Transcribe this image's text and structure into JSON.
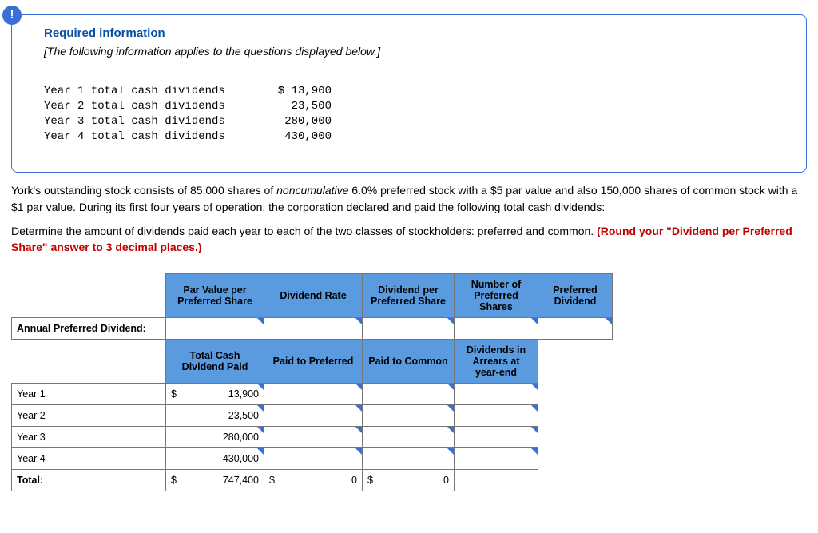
{
  "info": {
    "required_label": "Required information",
    "applies_text": "[The following information applies to the questions displayed below.]",
    "dividends": [
      {
        "label": "Year 1 total cash dividends",
        "value": "$ 13,900"
      },
      {
        "label": "Year 2 total cash dividends",
        "value": "23,500"
      },
      {
        "label": "Year 3 total cash dividends",
        "value": "280,000"
      },
      {
        "label": "Year 4 total cash dividends",
        "value": "430,000"
      }
    ]
  },
  "paragraph": {
    "p1a": "York's outstanding stock consists of 85,000 shares of ",
    "p1b": "noncumulative",
    "p1c": " 6.0% preferred stock with a $5 par value and also 150,000 shares of common stock with a $1 par value. During its first four years of operation, the corporation declared and paid the following total cash dividends:",
    "p2a": "Determine the amount of dividends paid each year to each of the two classes of stockholders: preferred and common. ",
    "p2b": "(Round your \"Dividend per Preferred Share\" answer to 3 decimal places.)"
  },
  "table": {
    "h1": {
      "par_value": "Par Value per Preferred Share",
      "rate": "Dividend Rate",
      "div_per_share": "Dividend per Preferred Share",
      "num_shares": "Number of Preferred Shares",
      "pref_div": "Preferred Dividend"
    },
    "annual_label": "Annual Preferred Dividend:",
    "h2": {
      "total_paid": "Total Cash Dividend Paid",
      "paid_pref": "Paid to Preferred",
      "paid_common": "Paid to Common",
      "arrears": "Dividends in Arrears at year-end"
    },
    "rows": [
      {
        "label": "Year 1",
        "cur": "$",
        "amt": "13,900"
      },
      {
        "label": "Year 2",
        "cur": "",
        "amt": "23,500"
      },
      {
        "label": "Year 3",
        "cur": "",
        "amt": "280,000"
      },
      {
        "label": "Year 4",
        "cur": "",
        "amt": "430,000"
      }
    ],
    "total": {
      "label": "Total:",
      "cur": "$",
      "amt": "747,400",
      "pref_cur": "$",
      "pref_val": "0",
      "com_cur": "$",
      "com_val": "0"
    }
  },
  "chart_data": {
    "type": "table",
    "title": "Total cash dividends by year",
    "categories": [
      "Year 1",
      "Year 2",
      "Year 3",
      "Year 4"
    ],
    "values": [
      13900,
      23500,
      280000,
      430000
    ],
    "total": 747400
  }
}
